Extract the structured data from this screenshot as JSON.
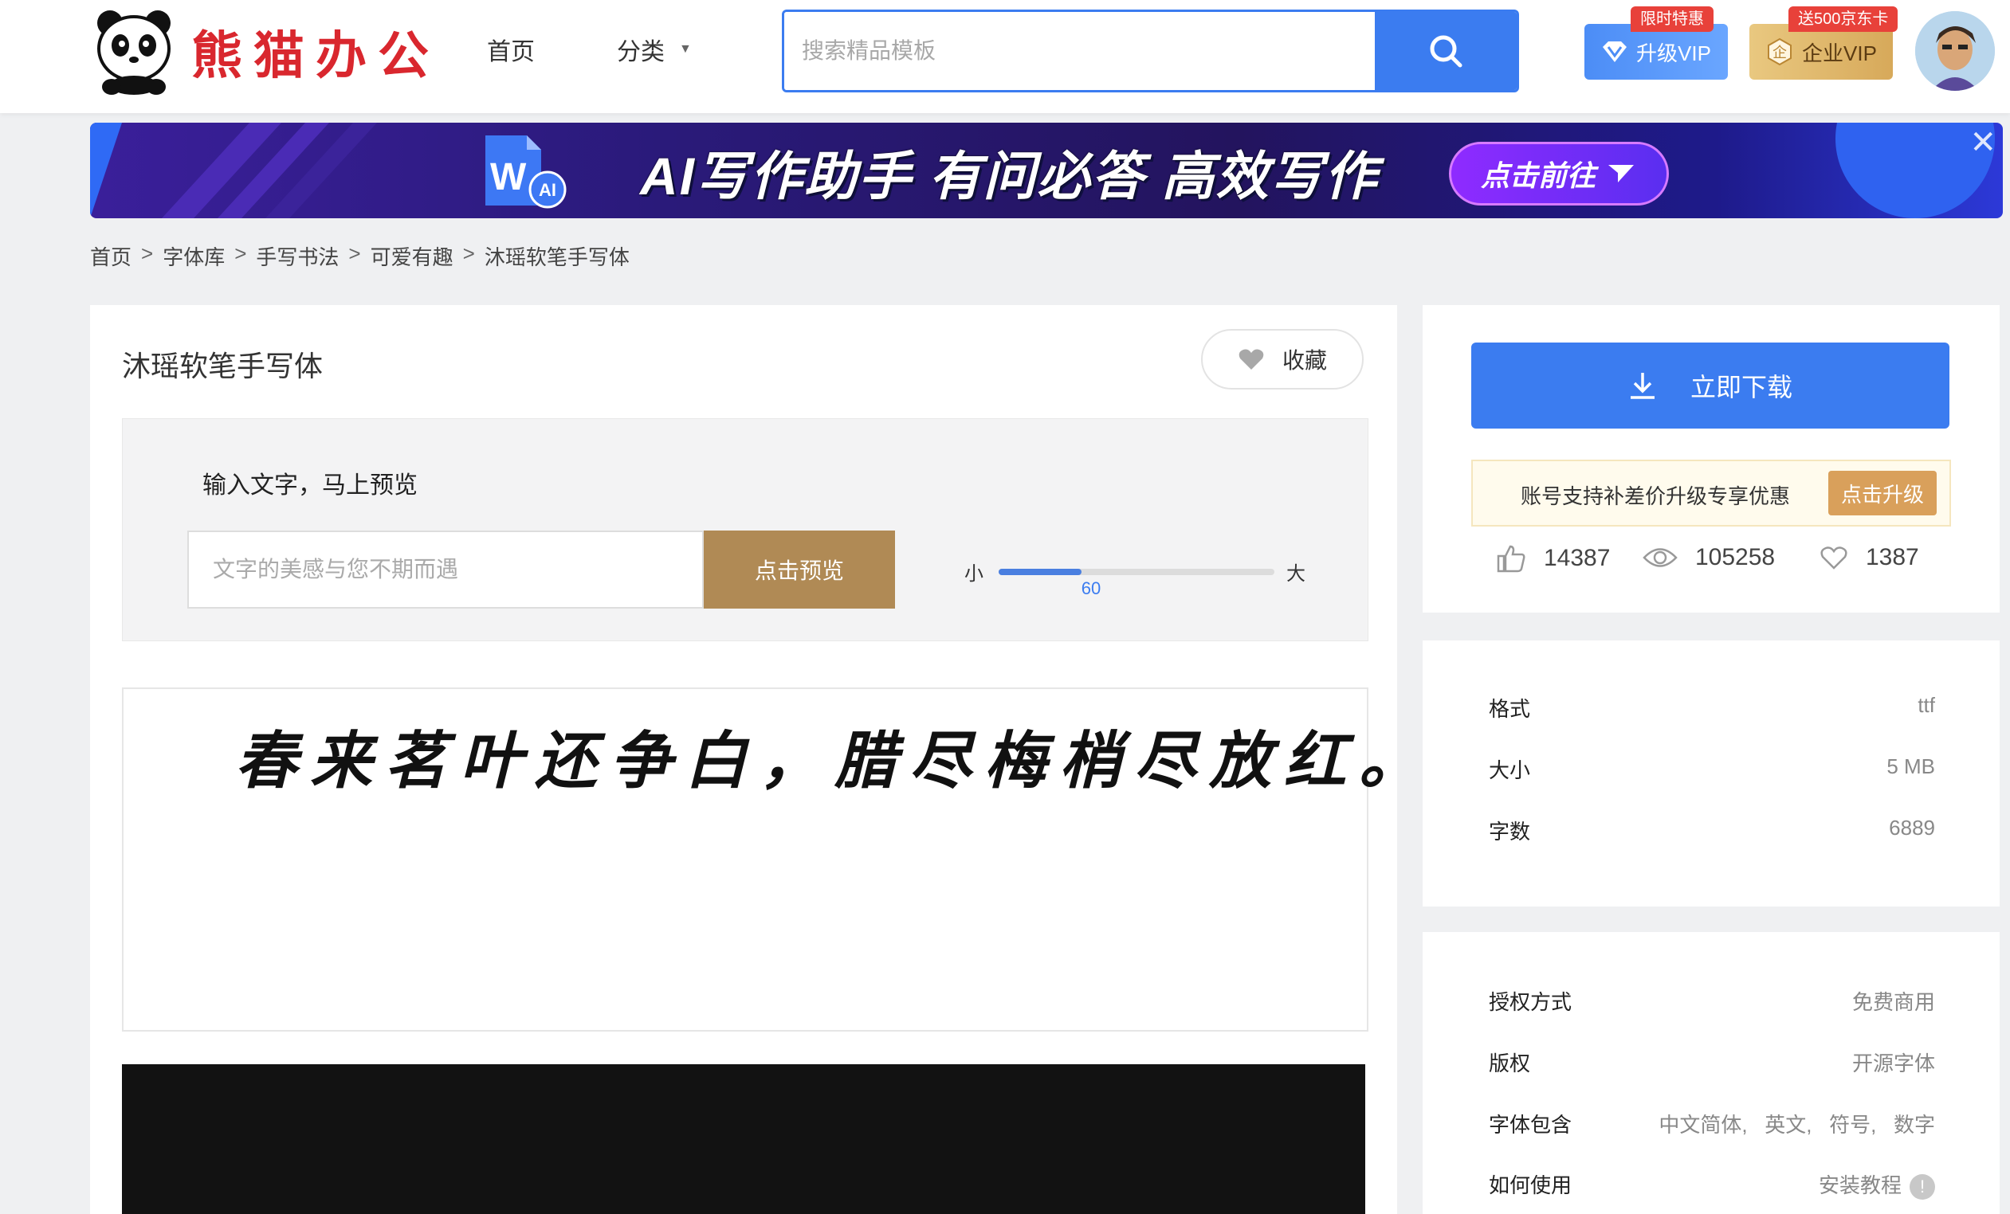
{
  "header": {
    "logo_text": "熊猫办公",
    "nav": {
      "home": "首页",
      "category": "分类"
    },
    "search": {
      "placeholder": "搜索精品模板"
    },
    "vip_upgrade": {
      "label": "升级VIP",
      "tag": "限时特惠"
    },
    "vip_enterprise": {
      "label": "企业VIP",
      "tag": "送500京东卡"
    }
  },
  "banner": {
    "title": "AI写作助手  有问必答  高效写作",
    "cta": "点击前往"
  },
  "breadcrumb": {
    "items": [
      "首页",
      "字体库",
      "手写书法",
      "可爱有趣",
      "沐瑶软笔手写体"
    ],
    "separator": ">"
  },
  "font": {
    "title": "沐瑶软笔手写体",
    "favorite_label": "收藏"
  },
  "preview": {
    "label": "输入文字，马上预览",
    "input_placeholder": "文字的美感与您不期而遇",
    "button_label": "点击预览",
    "size_small": "小",
    "size_large": "大",
    "size_value": "60",
    "size_fraction": 0.3
  },
  "sample": {
    "text": "春来茗叶还争白，腊尽梅梢尽放红。"
  },
  "download": {
    "button_label": "立即下载",
    "promo_text": "账号支持补差价升级专享优惠",
    "promo_button": "点击升级",
    "stats": {
      "likes": "14387",
      "views": "105258",
      "favorites": "1387"
    }
  },
  "specs": [
    {
      "label": "格式",
      "value": "ttf"
    },
    {
      "label": "大小",
      "value": "5 MB"
    },
    {
      "label": "字数",
      "value": "6889"
    }
  ],
  "license": [
    {
      "label": "授权方式",
      "value": "免费商用"
    },
    {
      "label": "版权",
      "value": "开源字体"
    },
    {
      "label": "字体包含",
      "value": "中文简体,   英文,   符号,   数字"
    },
    {
      "label": "如何使用",
      "value": "安装教程"
    }
  ],
  "colors": {
    "brand_red": "#d9272e",
    "primary_blue": "#3b7cf0",
    "gold": "#b08a55",
    "promo_orange": "#d9a05b"
  }
}
